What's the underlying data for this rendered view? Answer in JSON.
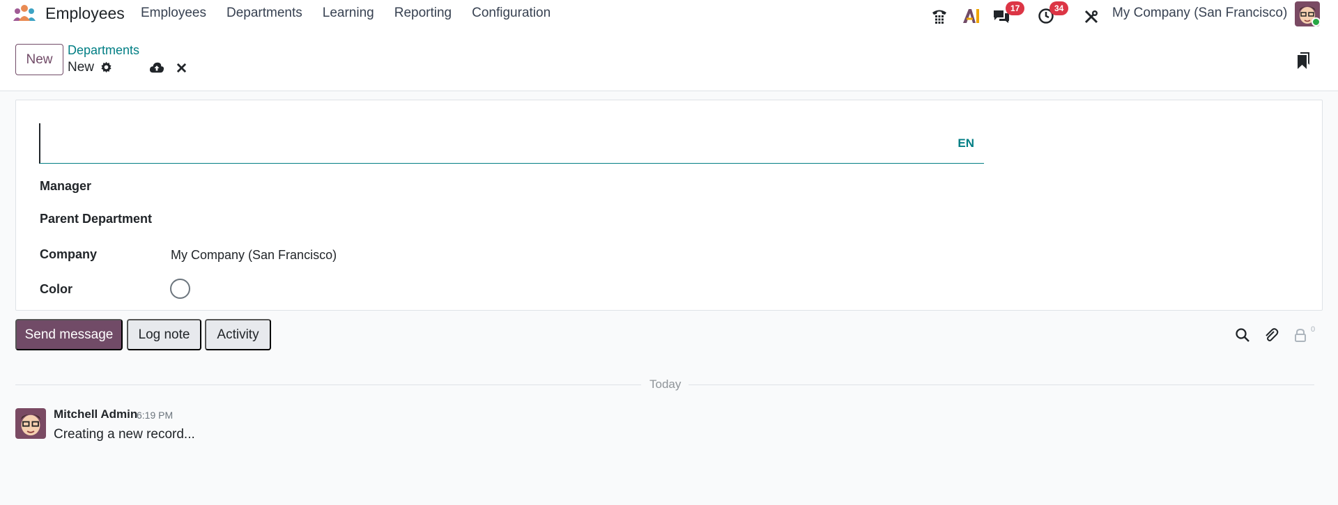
{
  "navbar": {
    "app_name": "Employees",
    "menu": [
      "Employees",
      "Departments",
      "Learning",
      "Reporting",
      "Configuration"
    ],
    "messages_badge": "17",
    "activities_badge": "34",
    "company": "My Company (San Francisco)"
  },
  "control_panel": {
    "new_label": "New",
    "breadcrumb": "Departments",
    "record_title": "New"
  },
  "form": {
    "name_value": "",
    "lang_label": "EN",
    "fields": {
      "manager_label": "Manager",
      "manager_value": "",
      "parent_label": "Parent Department",
      "parent_value": "",
      "company_label": "Company",
      "company_value": "My Company (San Francisco)",
      "color_label": "Color"
    }
  },
  "chatter": {
    "send_message": "Send message",
    "log_note": "Log note",
    "activity": "Activity",
    "followers_count": "0",
    "separator": "Today",
    "messages": [
      {
        "author": "Mitchell Admin",
        "time": "6:19 PM",
        "body": "Creating a new record..."
      }
    ]
  },
  "colors": {
    "brand": "#714b67",
    "teal": "#017e84",
    "badge": "#dc3545"
  }
}
